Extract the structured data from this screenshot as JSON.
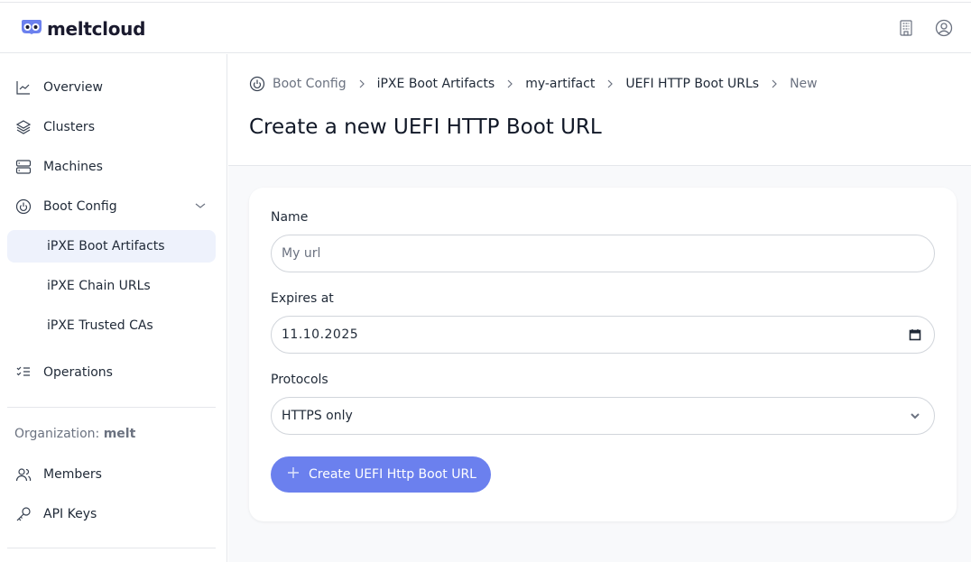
{
  "app": {
    "name": "meltcloud",
    "brand_color": "#6b80ee"
  },
  "header": {
    "icons": [
      "building-icon",
      "user-circle-icon"
    ]
  },
  "sidebar": {
    "items": [
      {
        "label": "Overview",
        "icon": "chart-line-icon"
      },
      {
        "label": "Clusters",
        "icon": "layers-icon"
      },
      {
        "label": "Machines",
        "icon": "server-icon"
      },
      {
        "label": "Boot Config",
        "icon": "power-icon",
        "expanded": true
      }
    ],
    "sub_items": [
      {
        "label": "iPXE Boot Artifacts",
        "active": true
      },
      {
        "label": "iPXE Chain URLs",
        "active": false
      },
      {
        "label": "iPXE Trusted CAs",
        "active": false
      }
    ],
    "operations": {
      "label": "Operations",
      "icon": "list-checks-icon"
    },
    "organization": {
      "prefix": "Organization:",
      "name": "melt"
    },
    "org_items": [
      {
        "label": "Members",
        "icon": "users-icon"
      },
      {
        "label": "API Keys",
        "icon": "key-icon"
      }
    ]
  },
  "breadcrumb": [
    {
      "label": "Boot Config",
      "muted": true
    },
    {
      "label": "iPXE Boot Artifacts",
      "muted": false
    },
    {
      "label": "my-artifact",
      "muted": false
    },
    {
      "label": "UEFI HTTP Boot URLs",
      "muted": false
    },
    {
      "label": "New",
      "muted": true
    }
  ],
  "page": {
    "title": "Create a new UEFI HTTP Boot URL"
  },
  "form": {
    "name": {
      "label": "Name",
      "value": "",
      "placeholder": "My url"
    },
    "expires_at": {
      "label": "Expires at",
      "value": "11.10.2025"
    },
    "protocols": {
      "label": "Protocols",
      "value": "HTTPS only"
    },
    "submit": {
      "label": "Create UEFI Http Boot URL",
      "icon": "plus-icon"
    }
  }
}
